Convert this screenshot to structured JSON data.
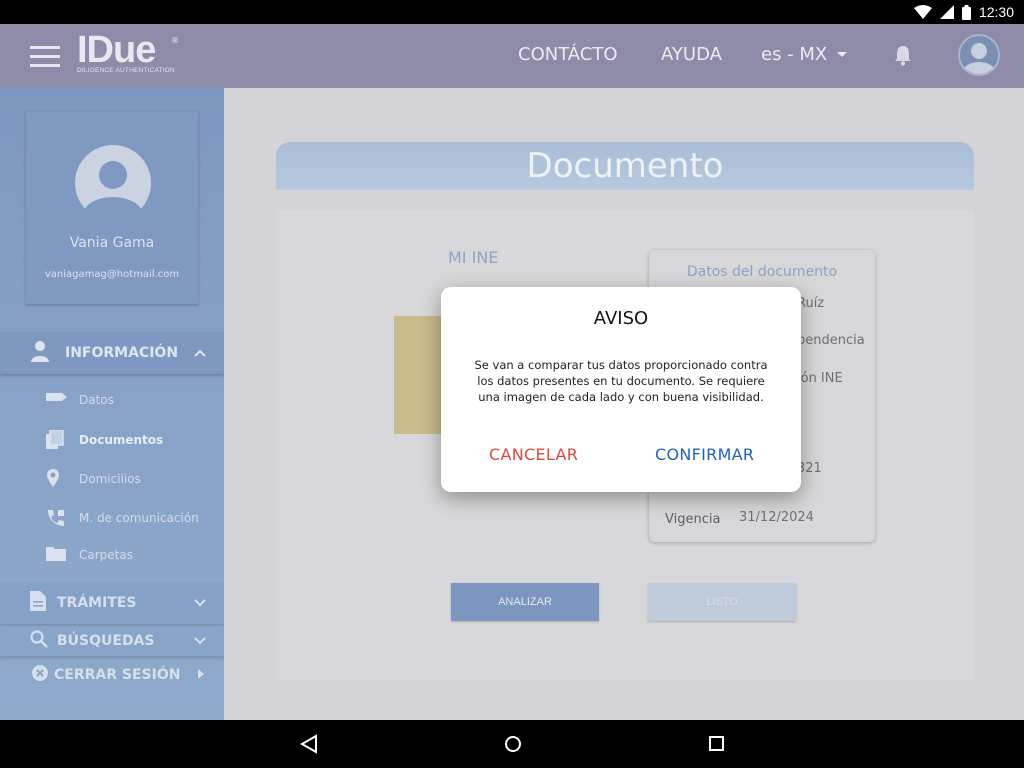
{
  "status_bar": {
    "time": "12:30"
  },
  "app_bar": {
    "logo_text": "IDue",
    "logo_tagline": "DILIGENCE AUTHENTICATION",
    "logo_reg": "®",
    "nav_contact": "CONTÁCTO",
    "nav_help": "AYUDA",
    "language": "es - MX"
  },
  "sidebar": {
    "profile": {
      "name": "Vania Gama",
      "email": "vaniagamag@hotmail.com"
    },
    "info_section": "INFORMACIÓN",
    "info_items": [
      {
        "label": "Datos",
        "icon": "label-icon"
      },
      {
        "label": "Documentos",
        "icon": "documents-icon"
      },
      {
        "label": "Domicilios",
        "icon": "location-pin-icon"
      },
      {
        "label": "M. de comunicación",
        "icon": "phone-icon"
      },
      {
        "label": "Carpetas",
        "icon": "folder-icon"
      }
    ],
    "tramites": "TRÁMITES",
    "busquedas": "BÚSQUEDAS",
    "cerrar_sesion": "CERRAR SESIÓN"
  },
  "main": {
    "title": "Documento",
    "doc_label": "MI INE",
    "datos": {
      "title": "Datos del documento",
      "row1": "Ruíz",
      "row2": "pendencia",
      "row3": "ión INE",
      "row4": "321",
      "vigencia_label": "Vigencia",
      "vigencia_value": "31/12/2024"
    },
    "analizar": "ANALIZAR",
    "listo": "LISTO"
  },
  "modal": {
    "title": "AVISO",
    "body": "Se van a comparar tus datos proporcionado contra los datos presentes en tu documento. Se requiere una imagen de cada lado y con buena visibilidad.",
    "cancel": "CANCELAR",
    "confirm": "CONFIRMAR"
  },
  "colors": {
    "app_bar": "#8e8ba9",
    "sidebar": "#7d97c2",
    "cancel": "#e0463d",
    "confirm": "#1f63b8"
  }
}
